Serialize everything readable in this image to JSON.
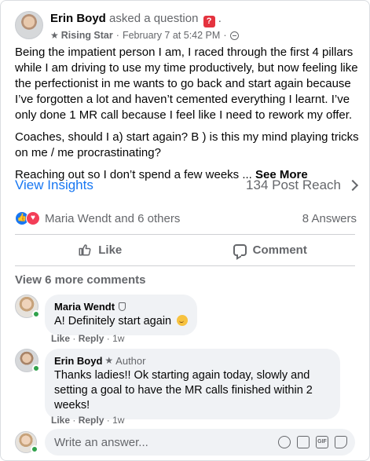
{
  "post": {
    "author_name": "Erin Boyd",
    "action_text": "asked a question",
    "action_suffix": ".",
    "question_icon": "question-icon",
    "badge_icon": "star-icon",
    "badge_label": "Rising Star",
    "separator": "·",
    "timestamp": "February 7 at 5:42 PM",
    "privacy_icon": "globe-icon",
    "paragraphs": [
      "Being the impatient person I am, I raced through the first 4 pillars while I am driving to use my time productively, but now feeling like the perfectionist in me wants to go back and start again because I’ve forgotten a lot and haven’t cemented everything I learnt. I’ve only done 1 MR call because I feel like I need to rework my offer.",
      "Coaches, should I a) start again? B ) is this my mind playing tricks on me / me procrastinating?"
    ],
    "truncated_text": "Reaching out so I don’t spend a few weeks ...",
    "see_more_label": "See More"
  },
  "insights": {
    "view_label": "View Insights",
    "reach_label": "134 Post Reach"
  },
  "reactions": {
    "summary": "Maria Wendt and 6 others",
    "answers_count": "8 Answers",
    "icons": [
      "like-icon",
      "love-icon"
    ]
  },
  "actions": {
    "like_label": "Like",
    "comment_label": "Comment"
  },
  "comments": {
    "view_more_label": "View 6 more comments",
    "items": [
      {
        "name": "Maria Wendt",
        "badge": "shield-icon",
        "author_tag": "",
        "text": "A! Definitely start again",
        "like_label": "Like",
        "reply_label": "Reply",
        "time": "1w"
      },
      {
        "name": "Erin Boyd",
        "badge": "star-icon",
        "author_tag": "Author",
        "text": "Thanks ladies!! Ok starting again today, slowly and setting a goal to have the MR calls finished within 2 weeks!",
        "like_label": "Like",
        "reply_label": "Reply",
        "time": "1w"
      }
    ]
  },
  "composer": {
    "placeholder": "Write an answer...",
    "tools": [
      "emoji-icon",
      "camera-icon",
      "gif-icon",
      "sticker-icon"
    ]
  },
  "colors": {
    "link_blue": "#1877f2",
    "secondary_text": "#65676b",
    "bubble_bg": "#f0f2f5",
    "online_green": "#31a24c",
    "question_red": "#e4333f"
  }
}
